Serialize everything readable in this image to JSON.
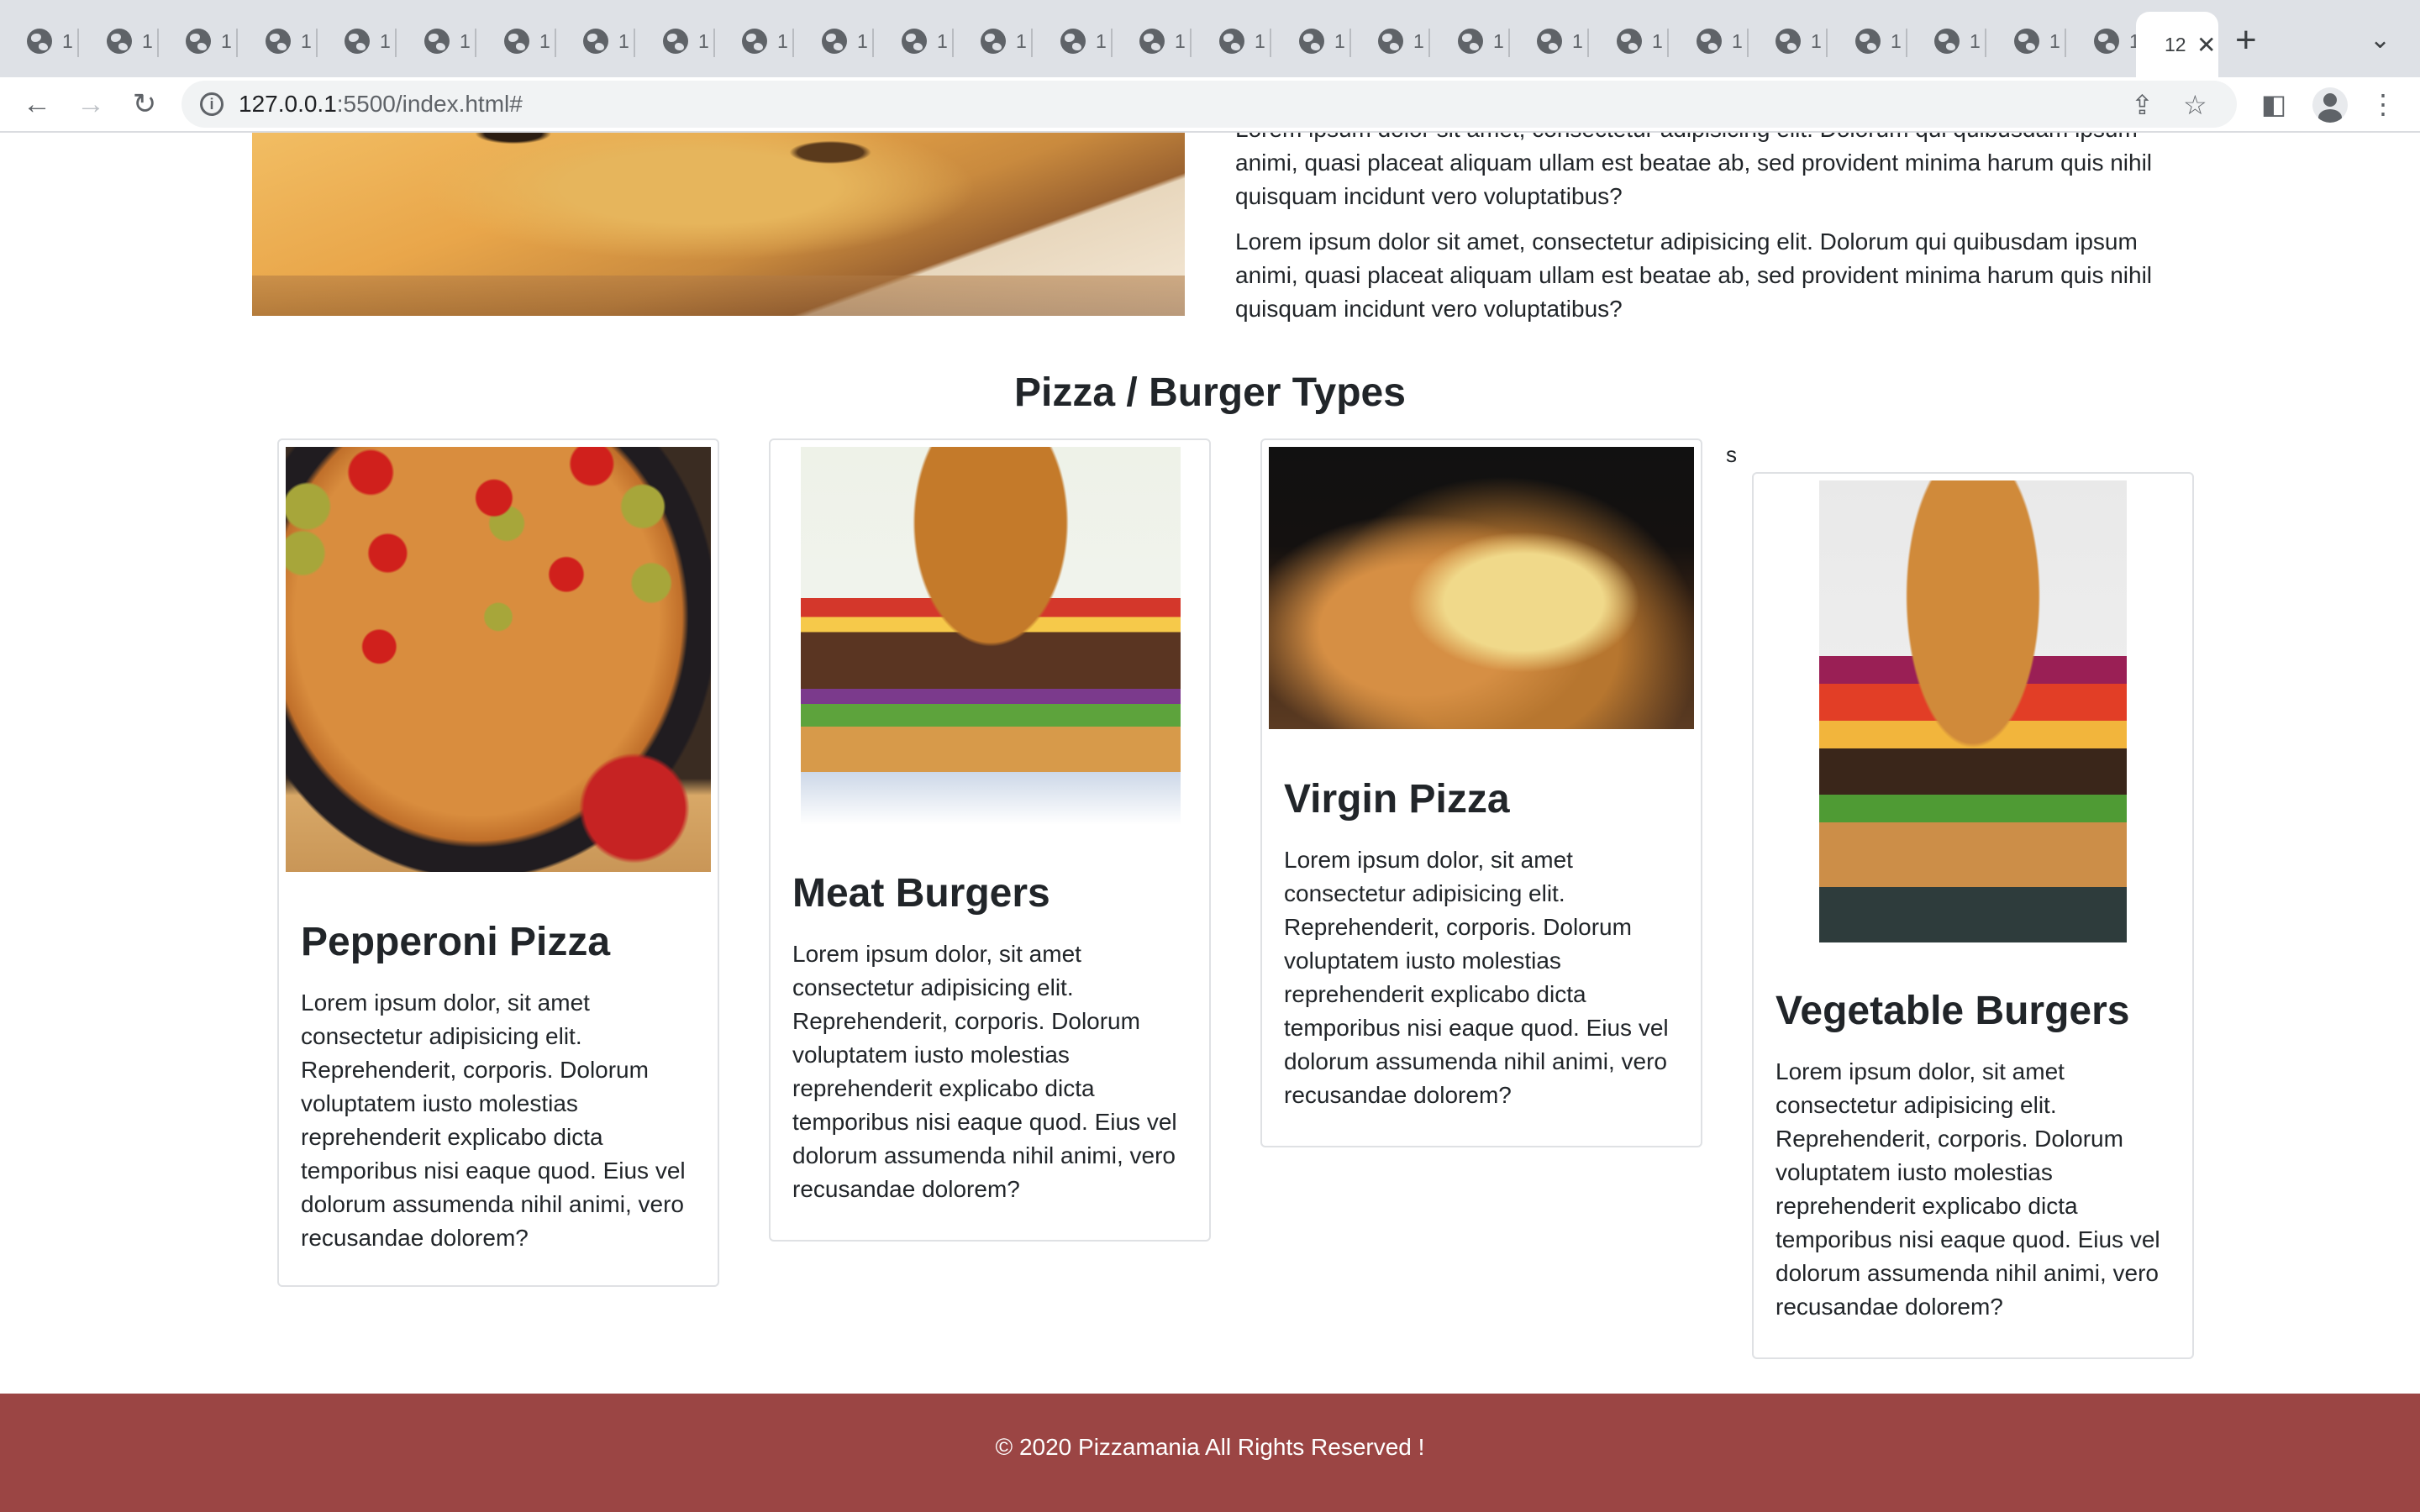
{
  "browser": {
    "tab_label": "1:",
    "active_tab_label": "12",
    "url_host": "127.0.0.1",
    "url_rest": ":5500/index.html#"
  },
  "about": {
    "paragraphs": [
      "Lorem ipsum dolor sit amet, consectetur adipisicing elit. Dolorum qui quibusdam ipsum animi, quasi placeat aliquam ullam est beatae ab, sed provident minima harum quis nihil quisquam incidunt vero voluptatibus?",
      "Lorem ipsum dolor sit amet, consectetur adipisicing elit. Dolorum qui quibusdam ipsum animi, quasi placeat aliquam ullam est beatae ab, sed provident minima harum quis nihil quisquam incidunt vero voluptatibus?"
    ]
  },
  "types": {
    "title": "Pizza / Burger Types",
    "stray_text": "s",
    "cards": [
      {
        "title": "Pepperoni Pizza",
        "text": "Lorem ipsum dolor, sit amet consectetur adipisicing elit. Reprehenderit, corporis. Dolorum voluptatem iusto molestias reprehenderit explicabo dicta temporibus nisi eaque quod. Eius vel dolorum assumenda nihil animi, vero recusandae dolorem?"
      },
      {
        "title": "Meat Burgers",
        "text": "Lorem ipsum dolor, sit amet consectetur adipisicing elit. Reprehenderit, corporis. Dolorum voluptatem iusto molestias reprehenderit explicabo dicta temporibus nisi eaque quod. Eius vel dolorum assumenda nihil animi, vero recusandae dolorem?"
      },
      {
        "title": "Virgin Pizza",
        "text": "Lorem ipsum dolor, sit amet consectetur adipisicing elit. Reprehenderit, corporis. Dolorum voluptatem iusto molestias reprehenderit explicabo dicta temporibus nisi eaque quod. Eius vel dolorum assumenda nihil animi, vero recusandae dolorem?"
      },
      {
        "title": "Vegetable Burgers",
        "text": "Lorem ipsum dolor, sit amet consectetur adipisicing elit. Reprehenderit, corporis. Dolorum voluptatem iusto molestias reprehenderit explicabo dicta temporibus nisi eaque quod. Eius vel dolorum assumenda nihil animi, vero recusandae dolorem?"
      }
    ]
  },
  "footer": {
    "text": "© 2020 Pizzamania All Rights Reserved !",
    "background": "#9b4544"
  },
  "icons": {
    "back": "arrow-left-icon",
    "forward": "arrow-right-icon",
    "reload": "reload-icon",
    "info": "info-icon",
    "share": "share-icon",
    "bookmark": "star-icon",
    "sidepanel": "side-panel-icon",
    "profile": "avatar-icon",
    "menu": "kebab-menu-icon"
  }
}
